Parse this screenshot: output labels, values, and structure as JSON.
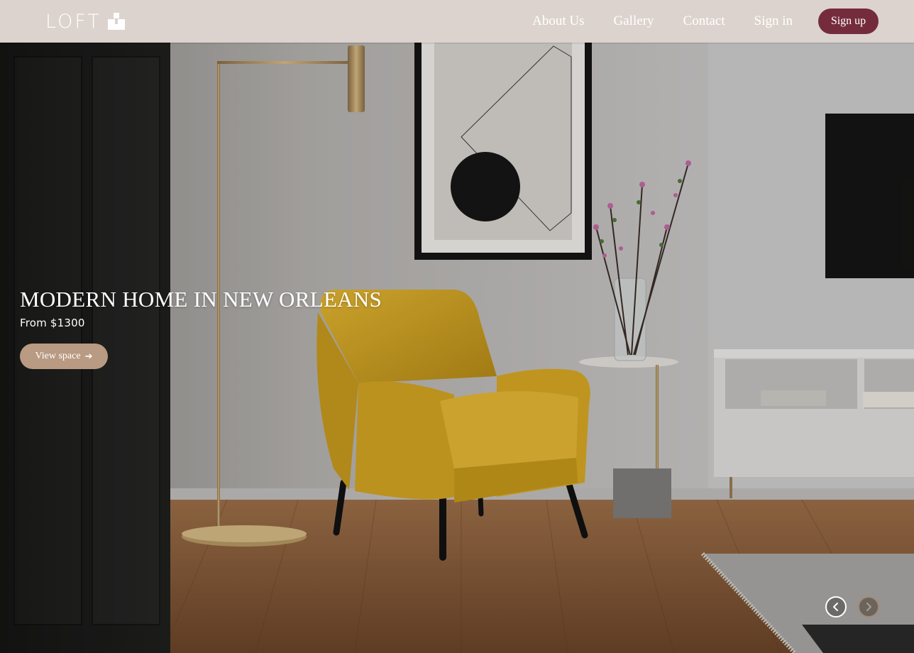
{
  "brand": {
    "name": "LOFT",
    "logo_icon": "stacked-blocks-icon"
  },
  "nav": {
    "links": [
      {
        "label": "About Us"
      },
      {
        "label": "Gallery"
      },
      {
        "label": "Contact"
      },
      {
        "label": "Sign in"
      }
    ],
    "signup_label": "Sign up"
  },
  "hero": {
    "title": "MODERN HOME IN NEW ORLEANS",
    "price": "From $1300",
    "cta_label": "View space",
    "cta_icon": "arrow-right-icon",
    "image": "living-room-photo",
    "prev_icon": "chevron-left-icon",
    "next_icon": "chevron-right-icon"
  },
  "colors": {
    "nav_bg": "#dcd3ce",
    "signup_bg": "#742c3c",
    "cta_bg": "#b99a82"
  }
}
